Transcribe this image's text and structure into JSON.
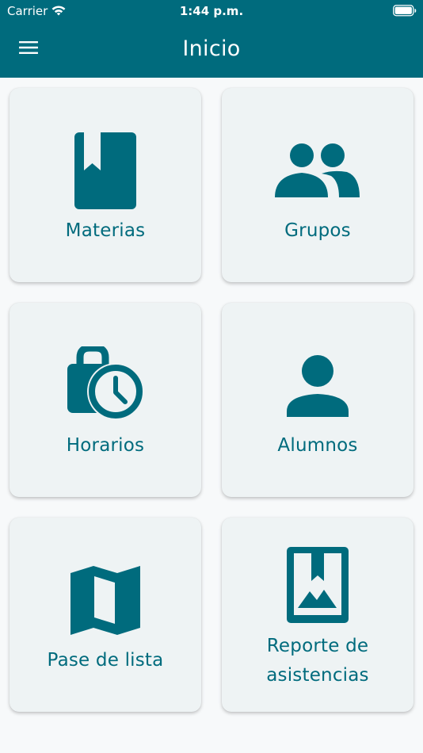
{
  "status_bar": {
    "carrier": "Carrier",
    "time": "1:44 p.m."
  },
  "app_bar": {
    "title": "Inicio",
    "menu_icon": "hamburger-menu-icon"
  },
  "colors": {
    "primary": "#006b7d",
    "card_background": "#eef3f4",
    "page_background": "#f7f9fa"
  },
  "cards": [
    {
      "label": "Materias",
      "icon": "book-bookmark-icon"
    },
    {
      "label": "Grupos",
      "icon": "people-icon"
    },
    {
      "label": "Horarios",
      "icon": "work-schedule-icon"
    },
    {
      "label": "Alumnos",
      "icon": "person-icon"
    },
    {
      "label": "Pase de lista",
      "icon": "map-icon"
    },
    {
      "label": "Reporte de\nasistencias",
      "icon": "photo-album-icon"
    }
  ]
}
